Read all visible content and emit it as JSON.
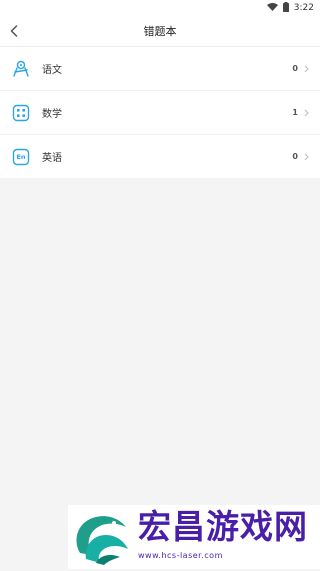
{
  "status_bar": {
    "time": "3:22"
  },
  "header": {
    "title": "错题本"
  },
  "subjects": [
    {
      "label": "语文",
      "count": "0",
      "icon": "chinese-subject-icon"
    },
    {
      "label": "数学",
      "count": "1",
      "icon": "math-subject-icon"
    },
    {
      "label": "英语",
      "count": "0",
      "icon": "english-subject-icon",
      "icon_text": "En"
    }
  ],
  "watermark": {
    "title": "宏昌游戏网",
    "url": "www.hcs-laser.com"
  },
  "colors": {
    "accent": "#2aa6e6",
    "watermark": "#4a1fa8"
  }
}
